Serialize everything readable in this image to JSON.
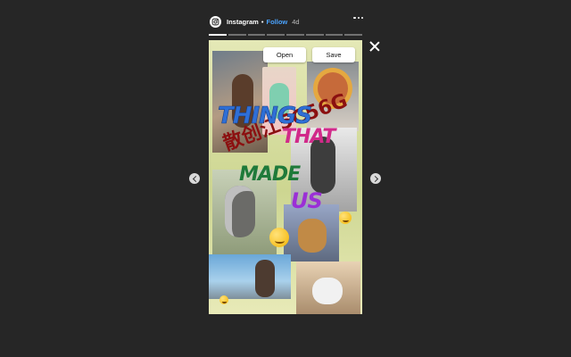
{
  "header": {
    "username": "Instagram",
    "separator": "•",
    "follow_label": "Follow",
    "time": "4d"
  },
  "progress": {
    "segments": 8,
    "active_index": 0
  },
  "story": {
    "buttons": {
      "open_label": "Open",
      "save_label": "Save"
    },
    "title_words": [
      "THINGS",
      "THAT",
      "MADE",
      "US"
    ],
    "scrawl_text": "散创江5C56G"
  },
  "colors": {
    "background": "#262626",
    "follow": "#4aa3ff",
    "story_background": "#d9dc9b"
  },
  "icons": {
    "logo": "instagram-logo-icon",
    "more": "more-options-icon",
    "close": "close-icon",
    "prev": "chevron-left-icon",
    "next": "chevron-right-icon"
  }
}
